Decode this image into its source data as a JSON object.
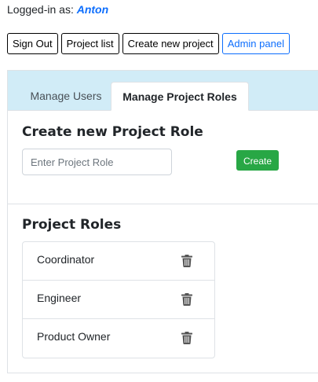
{
  "login": {
    "prefix": "Logged-in as:",
    "user": "Anton"
  },
  "nav": {
    "sign_out": "Sign Out",
    "project_list": "Project list",
    "create_project": "Create new project",
    "admin_panel": "Admin panel"
  },
  "tabs": [
    {
      "label": "Manage Users",
      "active": false
    },
    {
      "label": "Manage Project Roles",
      "active": true
    }
  ],
  "create_section": {
    "title": "Create new Project Role",
    "input_placeholder": "Enter Project Role",
    "input_value": "",
    "create_button": "Create"
  },
  "roles_section": {
    "title": "Project Roles",
    "roles": [
      {
        "name": "Coordinator",
        "delete_icon": "trash-icon"
      },
      {
        "name": "Engineer",
        "delete_icon": "trash-icon"
      },
      {
        "name": "Product Owner",
        "delete_icon": "trash-icon"
      }
    ]
  },
  "colors": {
    "link_blue": "#0d6efd",
    "tab_strip_bg": "#d1ecf7",
    "create_green": "#28a745",
    "icon_gray": "#555555"
  }
}
